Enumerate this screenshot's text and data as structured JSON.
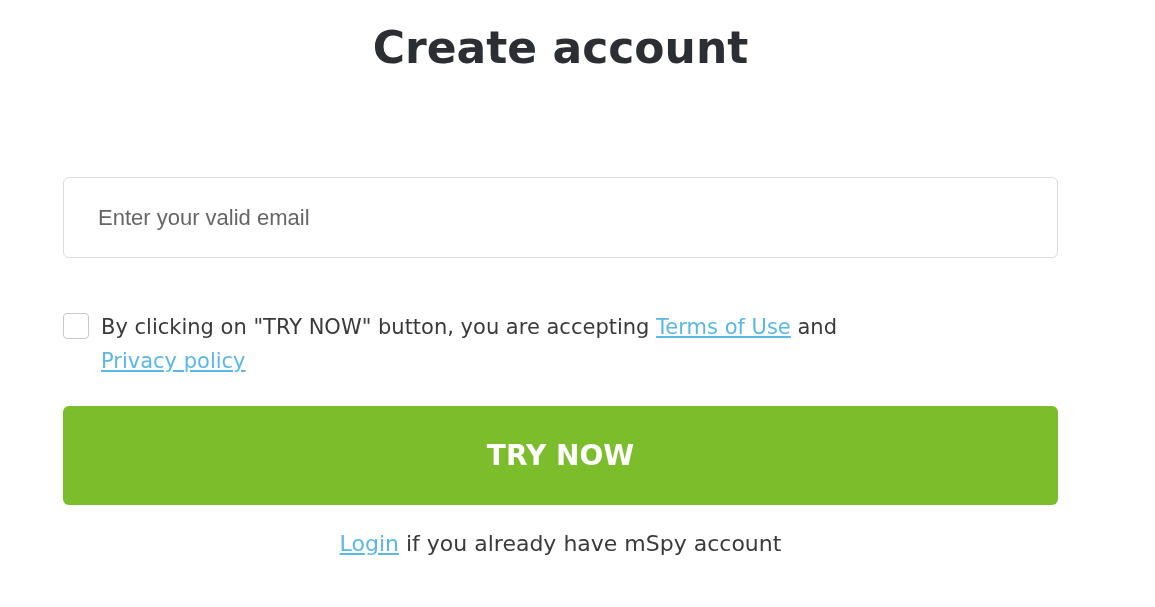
{
  "title": "Create account",
  "email": {
    "placeholder": "Enter your valid email"
  },
  "terms": {
    "checked": false,
    "text": "By clicking on \"TRY NOW\" button, you are accepting",
    "links": [
      {
        "label": "Terms of Use"
      },
      {
        "label": "Privacy policy"
      }
    ],
    "joiner": "and"
  },
  "submit": {
    "label": "TRY NOW"
  },
  "login": {
    "link": "Login",
    "text": "if you already have mSpy account"
  }
}
